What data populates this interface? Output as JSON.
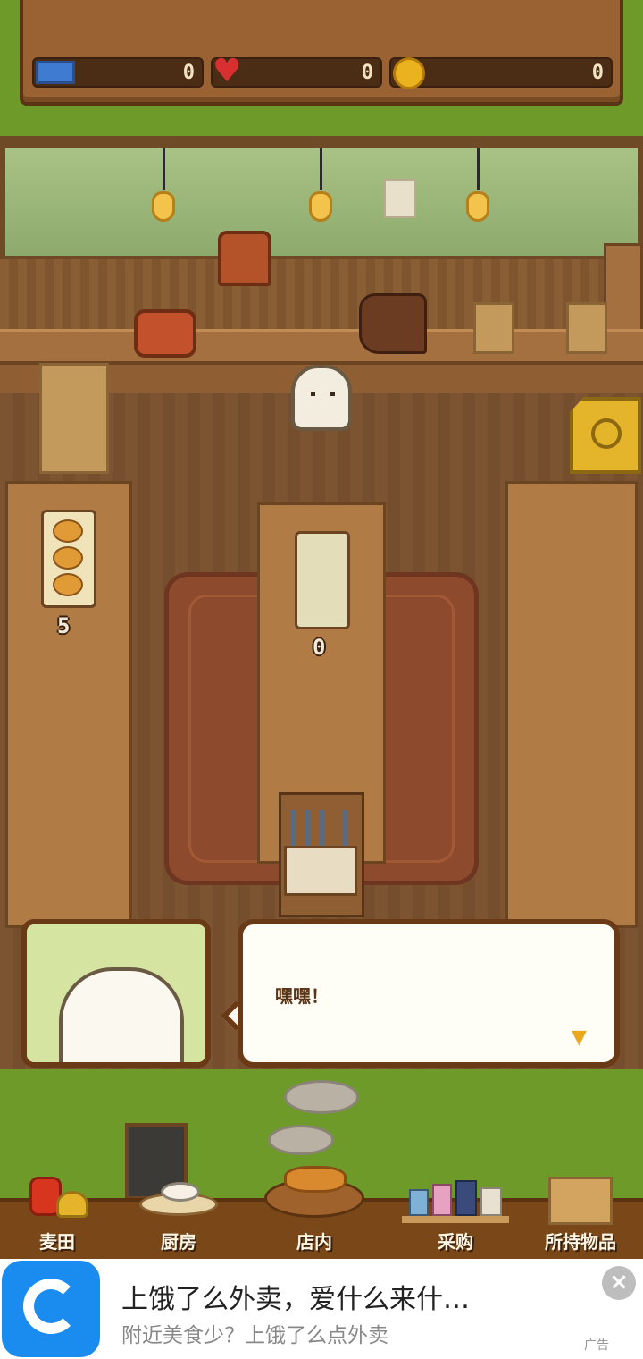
{
  "header": {
    "tickets": "0",
    "hearts": "0",
    "coins": "0"
  },
  "tray_counts": {
    "left": "5",
    "middle": "0"
  },
  "dialogue": {
    "text": "嘿嘿！",
    "continue_icon": "down-triangle-icon"
  },
  "nav": {
    "items": [
      {
        "label": "麦田",
        "icon": "wheat-icon"
      },
      {
        "label": "厨房",
        "icon": "kitchen-icon"
      },
      {
        "label": "店内",
        "icon": "bread-basket-icon"
      },
      {
        "label": "采购",
        "icon": "shop-icon"
      },
      {
        "label": "所持物品",
        "icon": "box-icon"
      }
    ]
  },
  "ad": {
    "title": "上饿了么外卖，爱什么来什…",
    "subtitle": "附近美食少？上饿了么点外卖",
    "close_symbol": "×",
    "tag": "广告"
  },
  "colors": {
    "grass": "#6e9a2a",
    "wood": "#7d5432",
    "ad_blue": "#1a8cf0"
  }
}
